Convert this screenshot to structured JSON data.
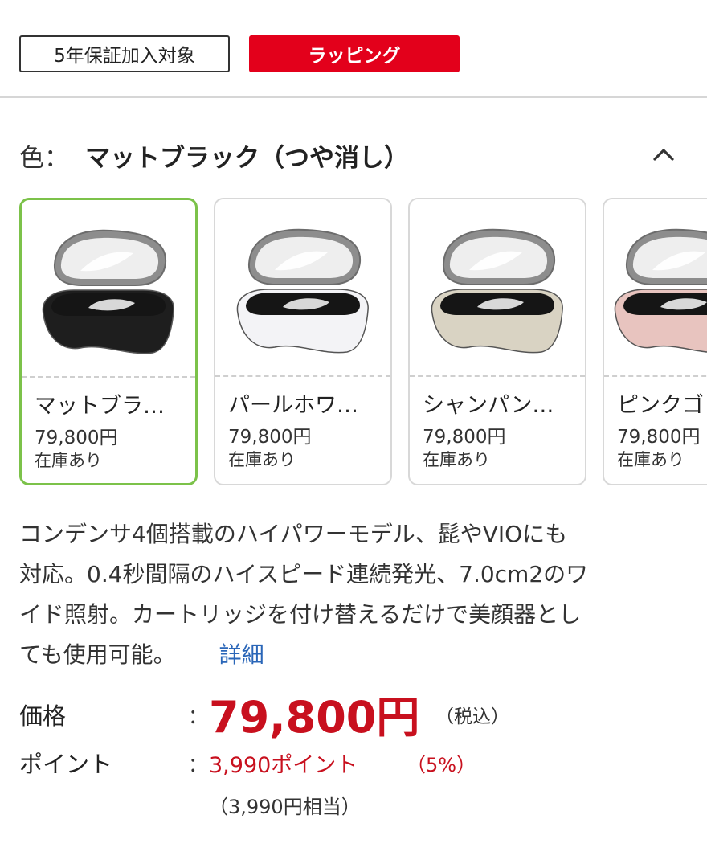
{
  "tags": {
    "warranty": "5年保証加入対象",
    "wrapping": "ラッピング"
  },
  "color": {
    "label": "色：",
    "selected": "マットブラック（つや消し）"
  },
  "variants": [
    {
      "name": "マットブラ…",
      "price": "79,800円",
      "stock": "在庫あり",
      "body_color": "#1e1e1e",
      "selected": true
    },
    {
      "name": "パールホワ…",
      "price": "79,800円",
      "stock": "在庫あり",
      "body_color": "#f3f3f6",
      "selected": false
    },
    {
      "name": "シャンパン…",
      "price": "79,800円",
      "stock": "在庫あり",
      "body_color": "#d9d3c3",
      "selected": false
    },
    {
      "name": "ピンクゴ",
      "price": "79,800円",
      "stock": "在庫あり",
      "body_color": "#e8c4bf",
      "selected": false
    }
  ],
  "description": {
    "line1": "コンデンサ4個搭載のハイパワーモデル、髭やVIOにも",
    "line2": "対応。0.4秒間隔のハイスピード連続発光、7.0cm2のワ",
    "line3": "イド照射。カートリッジを付け替えるだけで美顔器とし",
    "line4": "ても使用可能。",
    "detail_link": "詳細"
  },
  "price": {
    "label": "価格",
    "colon": "：",
    "value": "79,800円",
    "tax": "（税込）"
  },
  "points": {
    "label": "ポイント",
    "colon": "：",
    "value": "3,990ポイント",
    "percent": "（5%）",
    "equivalent": "（3,990円相当）"
  },
  "colors": {
    "accent_red": "#e3001b",
    "price_red": "#c8101e",
    "selected_border": "#7cc24a",
    "link_blue": "#2a66b8"
  }
}
